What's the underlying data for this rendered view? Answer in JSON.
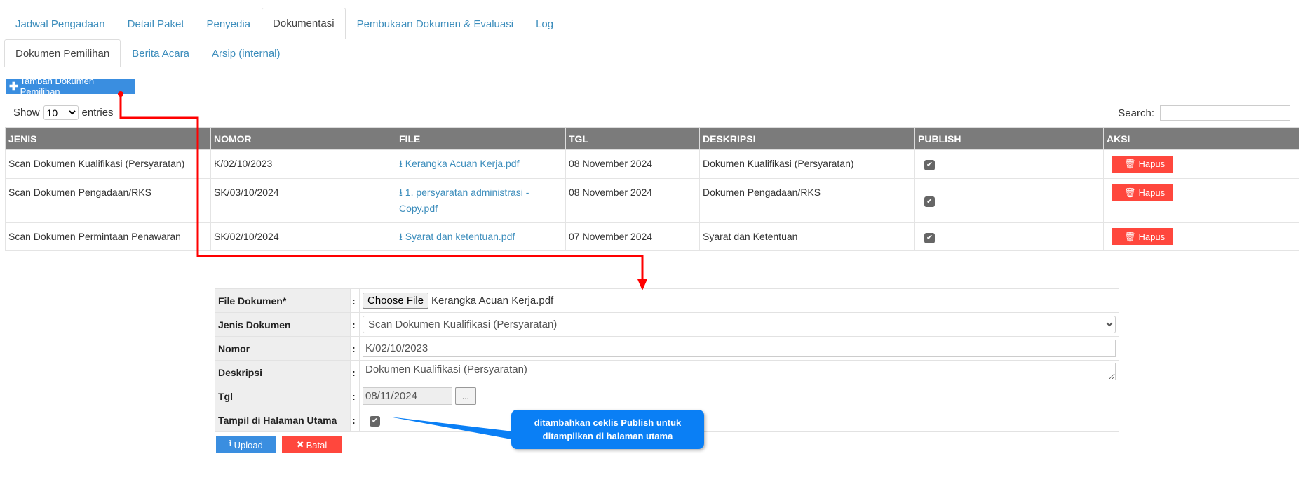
{
  "tabs": [
    "Jadwal Pengadaan",
    "Detail Paket",
    "Penyedia",
    "Dokumentasi",
    "Pembukaan Dokumen & Evaluasi",
    "Log"
  ],
  "subtabs": [
    "Dokumen Pemilihan",
    "Berita Acara",
    "Arsip (internal)"
  ],
  "add_button": "Tambah Dokumen Pemilihan",
  "show": {
    "label": "Show",
    "value": "10",
    "suffix": "entries"
  },
  "search": {
    "label": "Search:",
    "value": ""
  },
  "table": {
    "headers": [
      "JENIS",
      "NOMOR",
      "FILE",
      "TGL",
      "DESKRIPSI",
      "PUBLISH",
      "AKSI"
    ],
    "rows": [
      {
        "jenis": "Scan Dokumen Kualifikasi (Persyaratan)",
        "nomor": "K/02/10/2023",
        "file": "Kerangka Acuan Kerja.pdf",
        "tgl": "08 November 2024",
        "deskripsi": "Dokumen Kualifikasi (Persyaratan)",
        "publish": true,
        "aksi": "Hapus"
      },
      {
        "jenis": "Scan Dokumen Pengadaan/RKS",
        "nomor": "SK/03/10/2024",
        "file": "1. persyaratan administrasi - Copy.pdf",
        "tgl": "08 November 2024",
        "deskripsi": "Dokumen Pengadaan/RKS",
        "publish": true,
        "aksi": "Hapus"
      },
      {
        "jenis": "Scan Dokumen Permintaan Penawaran",
        "nomor": "SK/02/10/2024",
        "file": "Syarat dan ketentuan.pdf",
        "tgl": "07 November 2024",
        "deskripsi": "Syarat dan Ketentuan",
        "publish": true,
        "aksi": "Hapus"
      }
    ]
  },
  "form": {
    "file_label": "File Dokumen*",
    "choose_label": "Choose File",
    "file_name": "Kerangka Acuan Kerja.pdf",
    "jenis_label": "Jenis Dokumen",
    "jenis_value": "Scan Dokumen Kualifikasi (Persyaratan)",
    "nomor_label": "Nomor",
    "nomor_value": "K/02/10/2023",
    "deskripsi_label": "Deskripsi",
    "deskripsi_value": "Dokumen Kualifikasi (Persyaratan)",
    "tgl_label": "Tgl",
    "tgl_value": "08/11/2024",
    "tgl_btn": "...",
    "tampil_label": "Tampil di Halaman Utama",
    "tampil_checked": true,
    "colon": ":",
    "upload": "Upload",
    "batal": "Batal"
  },
  "callout": "ditambahkan ceklis Publish untuk ditampilkan di halaman utama"
}
